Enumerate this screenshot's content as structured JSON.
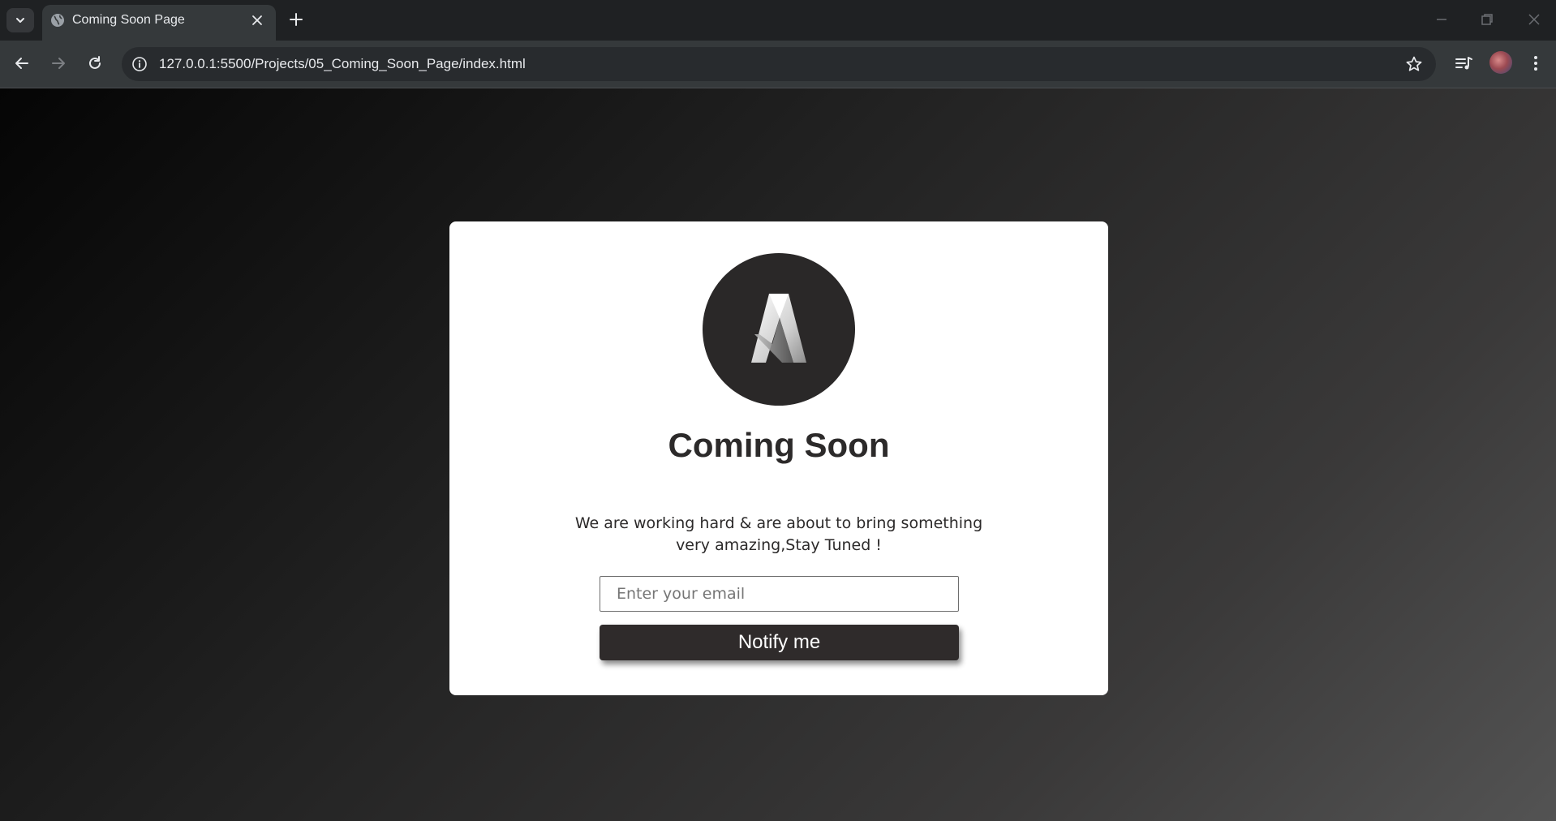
{
  "browser": {
    "tab_title": "Coming Soon Page",
    "url": "127.0.0.1:5500/Projects/05_Coming_Soon_Page/index.html",
    "icons": {
      "tab_search": "chevron-down-icon",
      "favicon": "globe-icon",
      "tab_close": "close-icon",
      "new_tab": "plus-icon",
      "back": "arrow-left-icon",
      "forward": "arrow-right-icon",
      "reload": "reload-icon",
      "site_info": "info-icon",
      "bookmark": "star-icon",
      "media": "media-queue-icon",
      "menu": "kebab-menu-icon"
    }
  },
  "page": {
    "logo_letter": "A",
    "heading": "Coming Soon",
    "message": "We are working hard & are about to bring something very amazing,Stay Tuned !",
    "email_placeholder": "Enter your email",
    "button_label": "Notify me"
  },
  "colors": {
    "card_background": "#ffffff",
    "logo_circle": "#2a2828",
    "button_background": "#2f2b2b",
    "text": "#2c2a2a"
  }
}
